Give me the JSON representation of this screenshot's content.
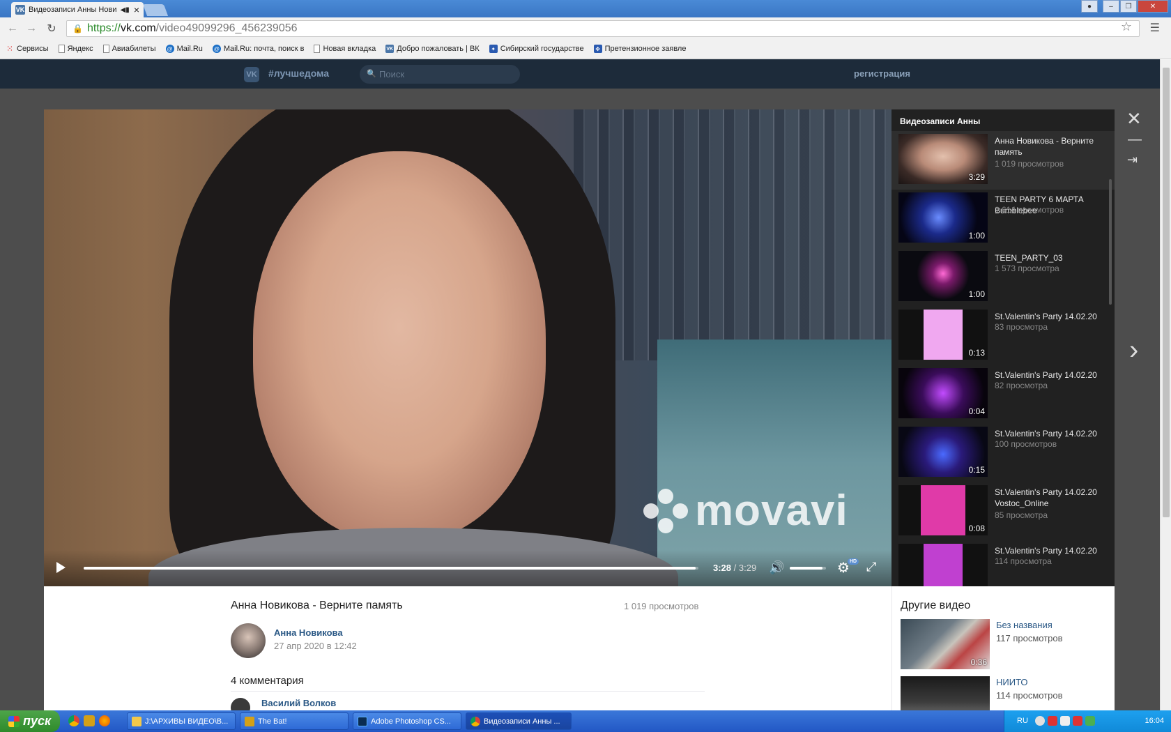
{
  "browser": {
    "tab_title": "Видеозаписи Анны Нови",
    "url_scheme": "https://",
    "url_host": "vk.com",
    "url_path": "/video49099296_456239056",
    "bookmarks": [
      "Сервисы",
      "Яндекс",
      "Авиабилеты",
      "Mail.Ru",
      "Mail.Ru: почта, поиск в",
      "Новая вкладка",
      "Добро пожаловать | ВК",
      "Сибирский государстве",
      "Претензионное заявле"
    ]
  },
  "vk_header": {
    "logo": "VK",
    "hashtag": "#лучшедома",
    "search_placeholder": "Поиск",
    "register": "регистрация"
  },
  "player": {
    "watermark": "movavi",
    "time_current": "3:28",
    "time_separator": " / ",
    "time_total": "3:29",
    "progress_fraction": 0.995,
    "volume_fraction": 0.9,
    "hd_badge": "HD"
  },
  "playlist": {
    "heading": "Видеозаписи Анны",
    "items": [
      {
        "title": "Анна Новикова - Верните память",
        "views": "1 019 просмотров",
        "duration": "3:29"
      },
      {
        "title": "TEEN PARTY 6 МАРТА Bumblebee",
        "views": "1 614 просмотров",
        "duration": "1:00"
      },
      {
        "title": "TEEN_PARTY_03",
        "views": "1 573 просмотра",
        "duration": "1:00"
      },
      {
        "title": "St.Valentin's Party 14.02.20",
        "views": "83 просмотра",
        "duration": "0:13"
      },
      {
        "title": "St.Valentin's Party 14.02.20",
        "views": "82 просмотра",
        "duration": "0:04"
      },
      {
        "title": "St.Valentin's Party 14.02.20",
        "views": "100 просмотров",
        "duration": "0:15"
      },
      {
        "title": "St.Valentin's Party 14.02.20 Vostoc_Online",
        "views": "85 просмотра",
        "duration": "0:08"
      },
      {
        "title": "St.Valentin's Party 14.02.20",
        "views": "114 просмотра",
        "duration": ""
      }
    ]
  },
  "video_info": {
    "title": "Анна Новикова - Верните память",
    "views": "1 019 просмотров",
    "author": "Анна Новикова",
    "date": "27 апр 2020 в 12:42",
    "comments_heading": "4 комментария",
    "first_commenter": "Василий Волков"
  },
  "other_videos": {
    "heading": "Другие видео",
    "items": [
      {
        "title": "Без названия",
        "views": "117 просмотров",
        "duration": "0:36"
      },
      {
        "title": "НИИТО",
        "views": "114 просмотров",
        "duration": ""
      }
    ]
  },
  "taskbar": {
    "start_label": "пуск",
    "tasks": [
      "J:\\АРХИВЫ ВИДЕО\\В...",
      "The Bat!",
      "Adobe Photoshop CS...",
      "Видеозаписи Анны ..."
    ],
    "language": "RU",
    "clock": "16:04"
  }
}
